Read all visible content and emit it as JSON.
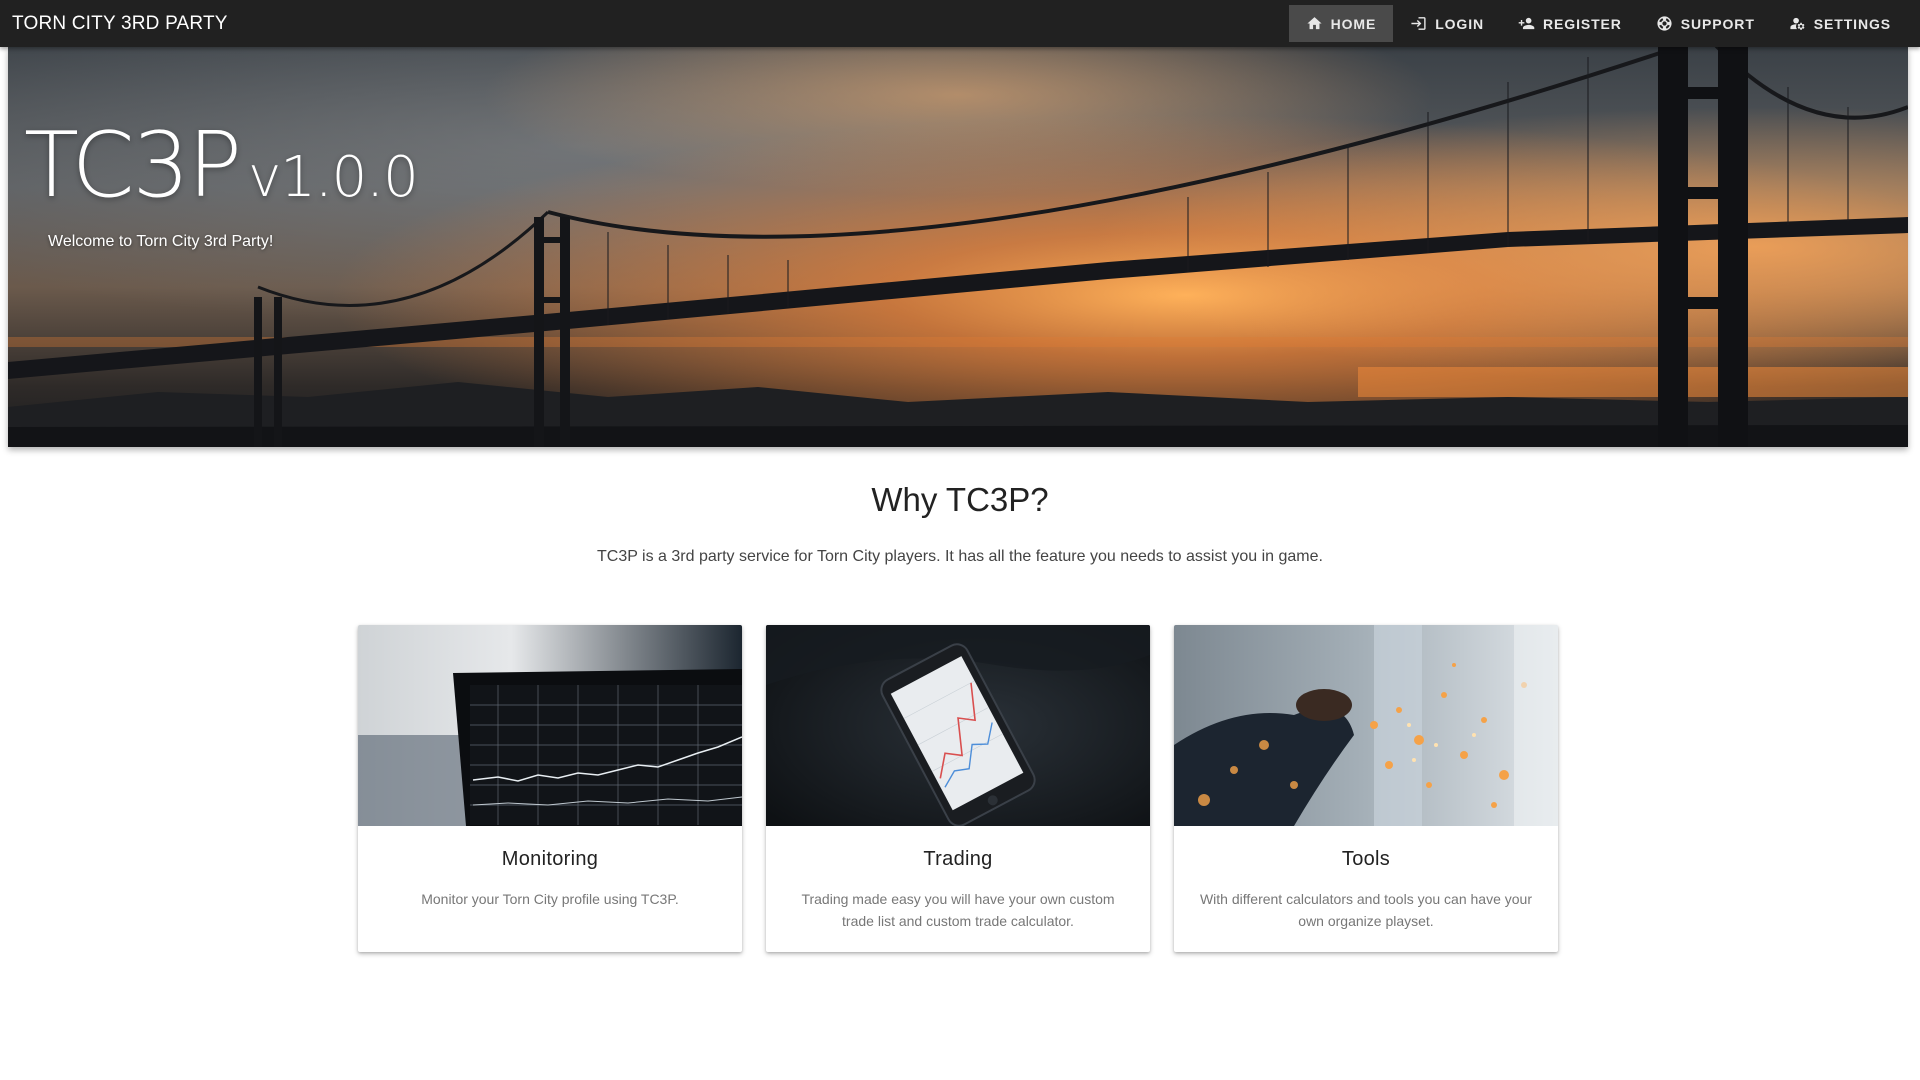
{
  "brand": "TORN CITY 3RD PARTY",
  "nav": {
    "items": [
      {
        "label": "HOME",
        "icon": "home-icon",
        "active": true
      },
      {
        "label": "LOGIN",
        "icon": "login-icon",
        "active": false
      },
      {
        "label": "REGISTER",
        "icon": "person-add-icon",
        "active": false
      },
      {
        "label": "SUPPORT",
        "icon": "support-icon",
        "active": false
      },
      {
        "label": "SETTINGS",
        "icon": "user-settings-icon",
        "active": false
      }
    ]
  },
  "hero": {
    "title": "TC3P",
    "version": "v1.0.0",
    "welcome": "Welcome to Torn City 3rd Party!"
  },
  "why": {
    "heading": "Why TC3P?",
    "text": "TC3P is a 3rd party service for Torn City players. It has all the feature you needs to assist you in game."
  },
  "cards": [
    {
      "title": "Monitoring",
      "text": "Monitor your Torn City profile using TC3P."
    },
    {
      "title": "Trading",
      "text": "Trading made easy you will have your own custom trade list and custom trade calculator."
    },
    {
      "title": "Tools",
      "text": "With different calculators and tools you can have your own organize playset."
    }
  ],
  "colors": {
    "navbar": "#212121",
    "nav_active": "#4a4a4a",
    "nav_text": "#e8e8e8"
  }
}
